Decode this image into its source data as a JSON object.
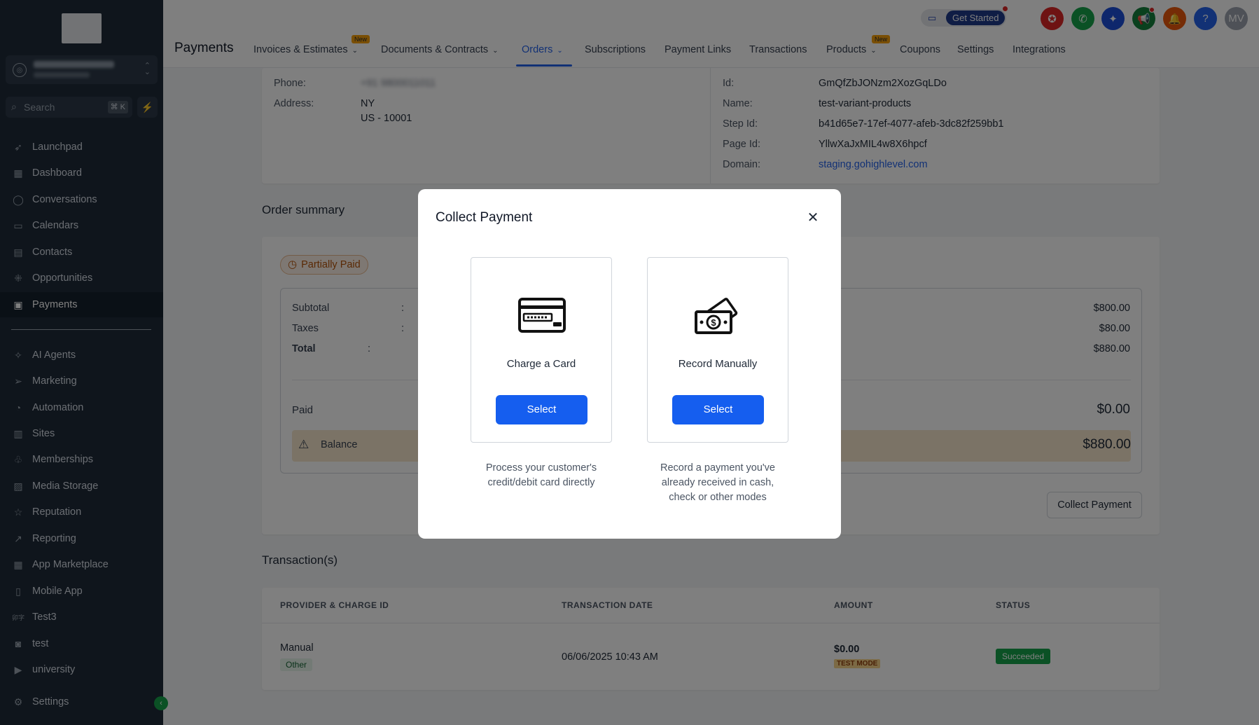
{
  "sidebar": {
    "search_placeholder": "Search",
    "search_shortcut": "⌘ K",
    "items": [
      {
        "label": "Launchpad"
      },
      {
        "label": "Dashboard"
      },
      {
        "label": "Conversations"
      },
      {
        "label": "Calendars"
      },
      {
        "label": "Contacts"
      },
      {
        "label": "Opportunities"
      },
      {
        "label": "Payments"
      },
      {
        "label": "AI Agents"
      },
      {
        "label": "Marketing"
      },
      {
        "label": "Automation"
      },
      {
        "label": "Sites"
      },
      {
        "label": "Memberships"
      },
      {
        "label": "Media Storage"
      },
      {
        "label": "Reputation"
      },
      {
        "label": "Reporting"
      },
      {
        "label": "App Marketplace"
      },
      {
        "label": "Mobile App"
      },
      {
        "label": "Test3"
      },
      {
        "label": "test"
      },
      {
        "label": "university"
      },
      {
        "label": "Settings"
      }
    ]
  },
  "header": {
    "title": "Payments",
    "tabs": [
      {
        "label": "Invoices & Estimates",
        "badge": "New"
      },
      {
        "label": "Documents & Contracts"
      },
      {
        "label": "Orders"
      },
      {
        "label": "Subscriptions"
      },
      {
        "label": "Payment Links"
      },
      {
        "label": "Transactions"
      },
      {
        "label": "Products",
        "badge": "New"
      },
      {
        "label": "Coupons"
      },
      {
        "label": "Settings"
      },
      {
        "label": "Integrations"
      }
    ],
    "get_started": "Get Started",
    "avatar_initials": "MV"
  },
  "customer": {
    "phone_label": "Phone:",
    "address_label": "Address:",
    "address_line1": "NY",
    "address_line2": "US - 10001"
  },
  "source": {
    "id_label": "Id:",
    "id_value": "GmQfZbJONzm2XozGqLDo",
    "name_label": "Name:",
    "name_value": "test-variant-products",
    "step_label": "Step Id:",
    "step_value": "b41d65e7-17ef-4077-afeb-3dc82f259bb1",
    "page_label": "Page Id:",
    "page_value": "YllwXaJxMIL4w8X6hpcf",
    "domain_label": "Domain:",
    "domain_value": "staging.gohighlevel.com"
  },
  "order_summary": {
    "title": "Order summary",
    "status": "Partially Paid",
    "subtotal_label": "Subtotal",
    "subtotal_value": "$800.00",
    "taxes_label": "Taxes",
    "taxes_value": "$80.00",
    "total_label": "Total",
    "total_value": "$880.00",
    "paid_label": "Paid",
    "paid_value": "$0.00",
    "balance_label": "Balance",
    "balance_value": "$880.00",
    "collect_button": "Collect Payment"
  },
  "transactions": {
    "title": "Transaction(s)",
    "columns": [
      "PROVIDER & CHARGE ID",
      "TRANSACTION DATE",
      "AMOUNT",
      "STATUS"
    ],
    "row": {
      "provider": "Manual",
      "provider_tag": "Other",
      "date": "06/06/2025 10:43 AM",
      "amount": "$0.00",
      "amount_tag": "TEST MODE",
      "status": "Succeeded"
    }
  },
  "modal": {
    "title": "Collect Payment",
    "options": [
      {
        "label": "Charge a Card",
        "button": "Select",
        "desc1": "Process your customer's",
        "desc2": "credit/debit card directly",
        "desc3": ""
      },
      {
        "label": "Record Manually",
        "button": "Select",
        "desc1": "Record a payment you've",
        "desc2": "already received in cash,",
        "desc3": "check or other modes"
      }
    ]
  },
  "colors": {
    "sidebar_bg": "#1e2a38",
    "primary_blue": "#155eef",
    "balance_bg": "#f6e7cc",
    "success_green": "#16a34a"
  }
}
